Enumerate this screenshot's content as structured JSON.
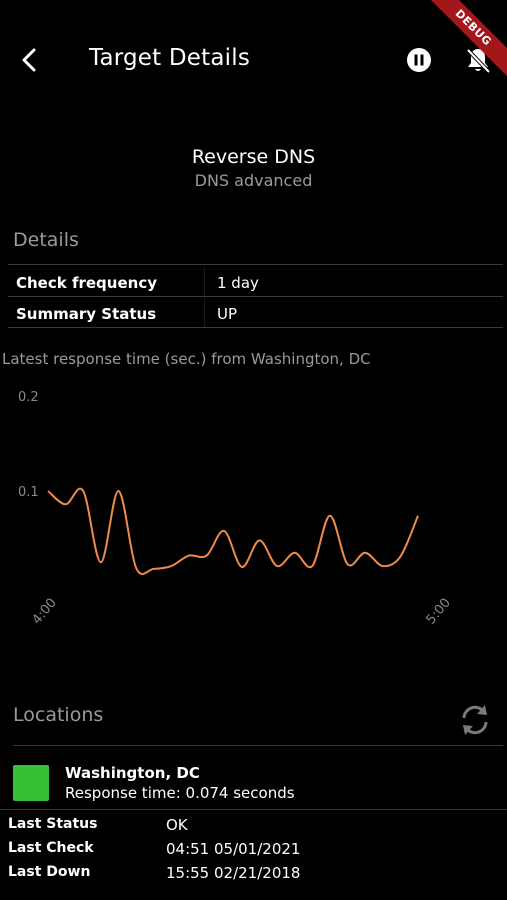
{
  "appbar": {
    "title": "Target Details",
    "debug_banner": "DEBUG",
    "icons": [
      "back-arrow-icon",
      "pause-icon",
      "notifications-off-icon"
    ]
  },
  "target": {
    "name": "Reverse DNS",
    "type": "DNS advanced"
  },
  "details": {
    "header": "Details",
    "rows": [
      {
        "label": "Check frequency",
        "value": "1 day"
      },
      {
        "label": "Summary Status",
        "value": "UP"
      }
    ]
  },
  "chart_caption": "Latest response time (sec.) from Washington, DC",
  "chart_data": {
    "type": "line",
    "title": "",
    "xlabel": "",
    "ylabel": "",
    "x_ticks": [
      "4:00",
      "5:00"
    ],
    "y_ticks": [
      "0.1",
      "0.2"
    ],
    "ylim": [
      0,
      0.2
    ],
    "color": "#ee8a4a",
    "series": [
      {
        "values": [
          0.1,
          0.086,
          0.1,
          0.025,
          0.1,
          0.019,
          0.018,
          0.021,
          0.032,
          0.032,
          0.058,
          0.02,
          0.048,
          0.021,
          0.035,
          0.021,
          0.074,
          0.023,
          0.035,
          0.021,
          0.031,
          0.074
        ]
      }
    ]
  },
  "locations": {
    "header": "Locations",
    "refresh_icon": "refresh-icon",
    "items": [
      {
        "name": "Washington, DC",
        "response": "Response time: 0.074 seconds",
        "status_color": "#35c133"
      }
    ]
  },
  "info": [
    {
      "label": "Last Status",
      "value": "OK"
    },
    {
      "label": "Last Check",
      "value": "04:51 05/01/2021"
    },
    {
      "label": "Last Down",
      "value": "15:55 02/21/2018"
    }
  ]
}
